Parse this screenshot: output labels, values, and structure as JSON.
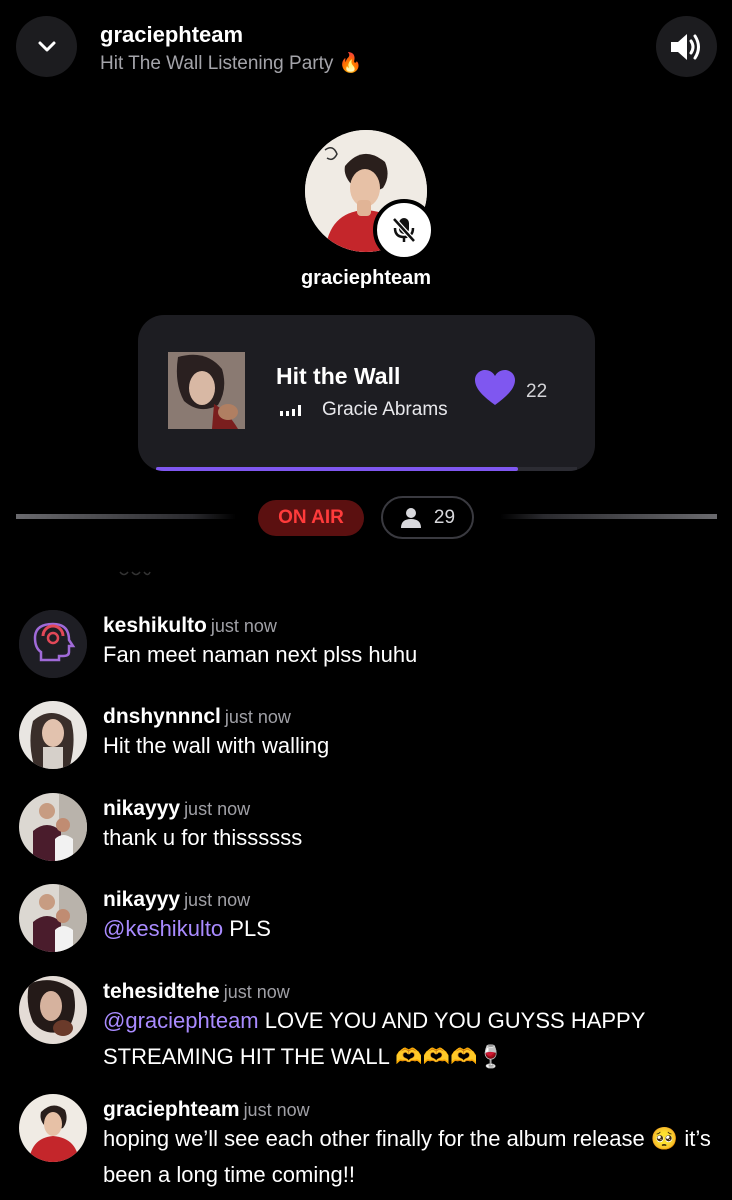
{
  "header": {
    "host_name": "graciephteam",
    "party_title": "Hit The Wall Listening Party 🔥"
  },
  "host": {
    "name": "graciephteam"
  },
  "now_playing": {
    "title": "Hit the Wall",
    "artist": "Gracie Abrams",
    "likes": "22",
    "progress": 0.86
  },
  "status": {
    "on_air": "ON AIR",
    "listeners": "29"
  },
  "colors": {
    "accent": "#7f57f0",
    "live": "#ff3b3b",
    "mention": "#a98bff"
  },
  "chat": [
    {
      "user": "keshikulto",
      "time": "just now",
      "mention": "",
      "text": "Fan meet naman next plss huhu"
    },
    {
      "user": "dnshynnncl",
      "time": "just now",
      "mention": "",
      "text": "Hit the wall with walling"
    },
    {
      "user": "nikayyy",
      "time": "just now",
      "mention": "",
      "text": "thank u for thissssss"
    },
    {
      "user": "nikayyy",
      "time": "just now",
      "mention": "@keshikulto",
      "text": " PLS"
    },
    {
      "user": "tehesidtehe",
      "time": "just now",
      "mention": "@graciephteam",
      "text": " LOVE YOU AND YOU GUYSS HAPPY STREAMING HIT THE WALL 🫶🫶🫶🍷"
    },
    {
      "user": "graciephteam",
      "time": "just now",
      "mention": "",
      "text": "hoping we’ll see each other finally for the album release 🥺 it’s been a long time coming!!"
    }
  ]
}
